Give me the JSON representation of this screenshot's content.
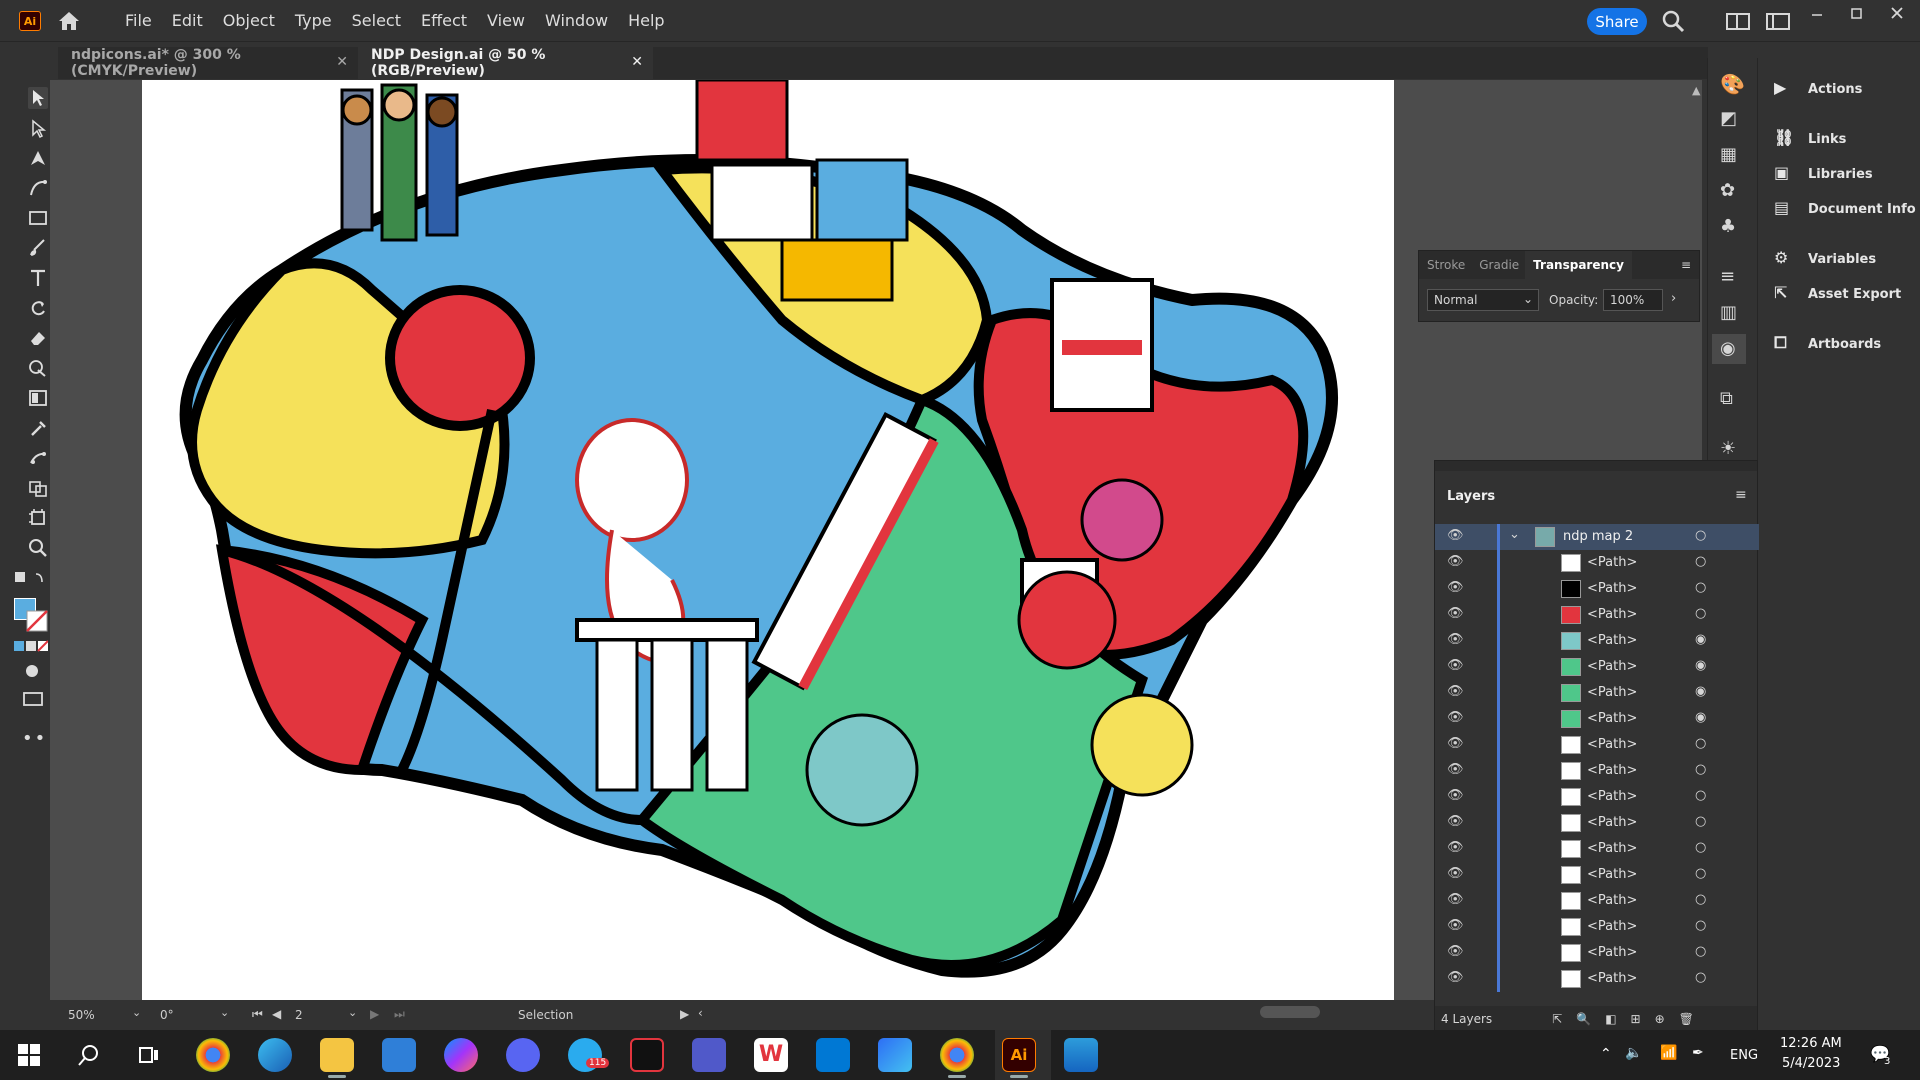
{
  "app": {
    "logo": "Ai",
    "share_label": "Share"
  },
  "menu": [
    "File",
    "Edit",
    "Object",
    "Type",
    "Select",
    "Effect",
    "View",
    "Window",
    "Help"
  ],
  "tabs": [
    {
      "label": "ndpicons.ai* @ 300 % (CMYK/Preview)",
      "active": false
    },
    {
      "label": "NDP Design.ai @ 50 % (RGB/Preview)",
      "active": true
    }
  ],
  "tools": [
    "selection-tool-icon",
    "direct-selection-tool-icon",
    "pen-tool-icon",
    "curvature-tool-icon",
    "rectangle-tool-icon",
    "paintbrush-tool-icon",
    "type-tool-icon",
    "rotate-tool-icon",
    "eraser-tool-icon",
    "shape-builder-tool-icon",
    "gradient-tool-icon",
    "eyedropper-tool-icon",
    "puppet-warp-tool-icon",
    "artboard-tool-icon",
    "zoom-tool-icon"
  ],
  "transparency_panel": {
    "tabs": [
      "Stroke",
      "Gradie",
      "Transparency"
    ],
    "blend_mode": "Normal",
    "opacity_label": "Opacity:",
    "opacity_value": "100%"
  },
  "right_panel": {
    "items": [
      "Actions",
      "Links",
      "Libraries",
      "Document Info",
      "Variables",
      "Asset Export",
      "Artboards"
    ]
  },
  "layers_panel": {
    "title": "Layers",
    "top_layer": "ndp map 2",
    "rows": [
      "<Path>",
      "<Path>",
      "<Path>",
      "<Path>",
      "<Path>",
      "<Path>",
      "<Path>",
      "<Path>",
      "<Path>",
      "<Path>",
      "<Path>",
      "<Path>",
      "<Path>",
      "<Path>",
      "<Path>",
      "<Path>",
      "<Path>"
    ],
    "footer": "4 Layers"
  },
  "statusbar": {
    "zoom": "50%",
    "rotation": "0°",
    "artboard_number": "2",
    "tool_name": "Selection"
  },
  "taskbar": {
    "lang": "ENG",
    "time": "12:26 AM",
    "date": "5/4/2023",
    "telegram_badge": "115",
    "notif_count": "3"
  },
  "colors": {
    "accent": "#1473e6",
    "map_blue": "#5aade0",
    "map_yellow": "#f5e15a",
    "map_red": "#e2353e",
    "map_green": "#4fc78a"
  }
}
